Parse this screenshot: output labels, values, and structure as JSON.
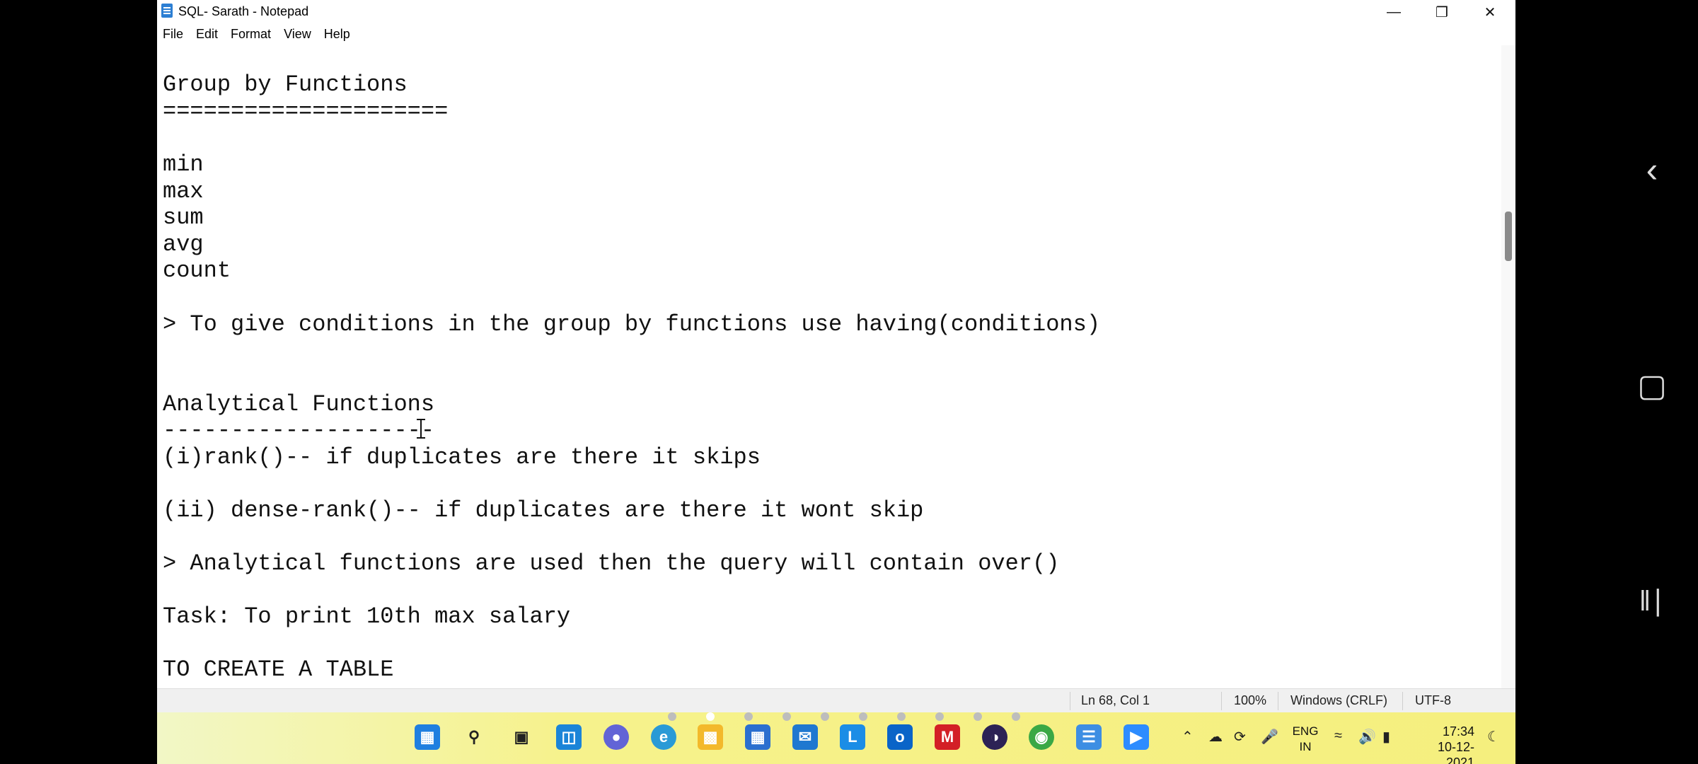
{
  "window": {
    "title": "SQL- Sarath - Notepad"
  },
  "menu": [
    "File",
    "Edit",
    "Format",
    "View",
    "Help"
  ],
  "editor_lines": [
    "Group by Functions",
    "=====================",
    "",
    "min",
    "max",
    "sum",
    "avg",
    "count",
    "",
    "> To give conditions in the group by functions use having(conditions)",
    "",
    "",
    "Analytical Functions",
    "--------------------",
    "(i)rank()-- if duplicates are there it skips",
    "",
    "(ii) dense-rank()-- if duplicates are there it wont skip",
    "",
    "> Analytical functions are used then the query will contain over()",
    "",
    "Task: To print 10th max salary",
    "",
    "TO CREATE A TABLE",
    "------------------"
  ],
  "status": {
    "position": "Ln 68, Col 1",
    "zoom": "100%",
    "line_ending": "Windows (CRLF)",
    "encoding": "UTF-8"
  },
  "taskbar": {
    "icons": [
      "windows-start-icon",
      "search-icon",
      "task-view-icon",
      "widgets-icon",
      "chat-icon",
      "edge-icon",
      "file-explorer-icon",
      "store-icon",
      "mail-icon",
      "l-app-icon",
      "outlook-icon",
      "mcafee-icon",
      "eclipse-icon",
      "chrome-icon",
      "notepad-icon",
      "zoom-icon"
    ],
    "lang_top": "ENG",
    "lang_bottom": "IN",
    "time": "17:34",
    "date": "10-12-2021"
  },
  "colors": {
    "taskbar": "#f6f28c",
    "scroll_thumb": "#8a8a8a"
  }
}
